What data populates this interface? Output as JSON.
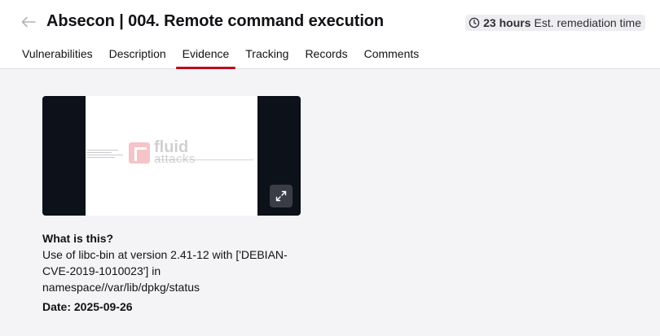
{
  "header": {
    "title": "Absecon | 004. Remote command execution",
    "remediation": {
      "hours": "23 hours",
      "label": "Est. remediation time"
    }
  },
  "tabs": [
    {
      "label": "Vulnerabilities",
      "active": false
    },
    {
      "label": "Description",
      "active": false
    },
    {
      "label": "Evidence",
      "active": true
    },
    {
      "label": "Tracking",
      "active": false
    },
    {
      "label": "Records",
      "active": false
    },
    {
      "label": "Comments",
      "active": false
    }
  ],
  "evidence": {
    "logo_line1": "fluid",
    "logo_line2": "attacks",
    "question": "What is this?",
    "description": "Use of libc-bin at version 2.41-12 with ['DEBIAN-CVE-2019-1010023'] in namespace//var/lib/dpkg/status",
    "date_label": "Date: 2025-09-26"
  },
  "colors": {
    "accent": "#bf0b1a",
    "card_bg": "#0d111a",
    "page_bg": "#f4f4f6"
  }
}
